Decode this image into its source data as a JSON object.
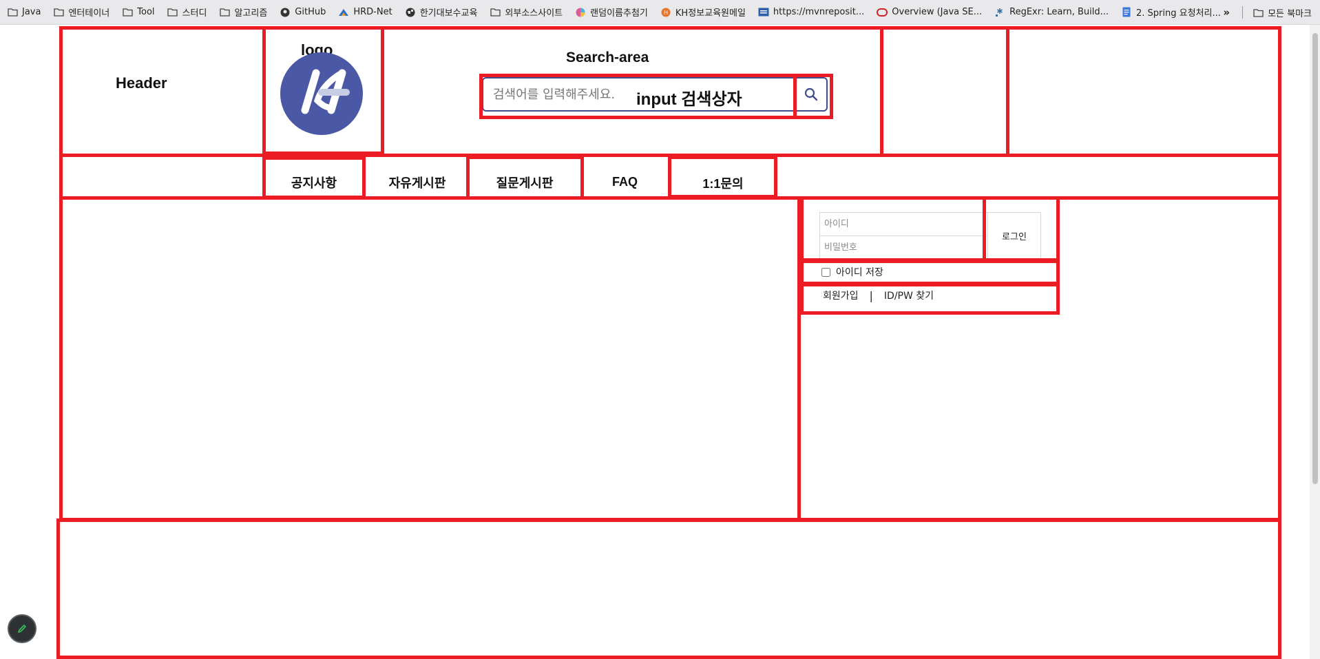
{
  "bookmarks": [
    {
      "label": "Java",
      "icon": "folder-icon"
    },
    {
      "label": "엔터테이너",
      "icon": "folder-icon"
    },
    {
      "label": "Tool",
      "icon": "folder-icon"
    },
    {
      "label": "스터디",
      "icon": "folder-icon"
    },
    {
      "label": "알고리즘",
      "icon": "folder-icon"
    },
    {
      "label": "GitHub",
      "icon": "github-icon"
    },
    {
      "label": "HRD-Net",
      "icon": "hrd-icon"
    },
    {
      "label": "한기대보수교육",
      "icon": "globe-icon"
    },
    {
      "label": "외부소스사이트",
      "icon": "folder-icon"
    },
    {
      "label": "랜덤이름추첨기",
      "icon": "color-wheel-icon"
    },
    {
      "label": "KH정보교육원메일",
      "icon": "kh-icon"
    },
    {
      "label": "https://mvnreposit...",
      "icon": "mvn-icon"
    },
    {
      "label": "Overview (Java SE...",
      "icon": "oracle-icon"
    },
    {
      "label": "RegExr: Learn, Build...",
      "icon": "regexr-icon"
    },
    {
      "label": "2. Spring 요청처리...",
      "icon": "doc-icon"
    }
  ],
  "bookmarks_more": "»",
  "bookmarks_all": "모든 북마크",
  "layout_labels": {
    "header": "Header",
    "logo": "logo",
    "logo_text": "KH",
    "search_area": "Search-area",
    "input_box": "input 검색상자"
  },
  "search": {
    "placeholder": "검색어를 입력해주세요."
  },
  "nav": [
    "공지사항",
    "자유게시판",
    "질문게시판",
    "FAQ",
    "1:1문의"
  ],
  "login": {
    "id_placeholder": "아이디",
    "pw_placeholder": "비밀번호",
    "login_button": "로그인",
    "remember_id": "아이디 저장",
    "signup": "회원가입",
    "separator": "|",
    "find": "ID/PW 찾기"
  },
  "colors": {
    "outline": "#ec1c24",
    "logo_bg": "#4a58a6",
    "search_border": "#3f4c8c"
  }
}
